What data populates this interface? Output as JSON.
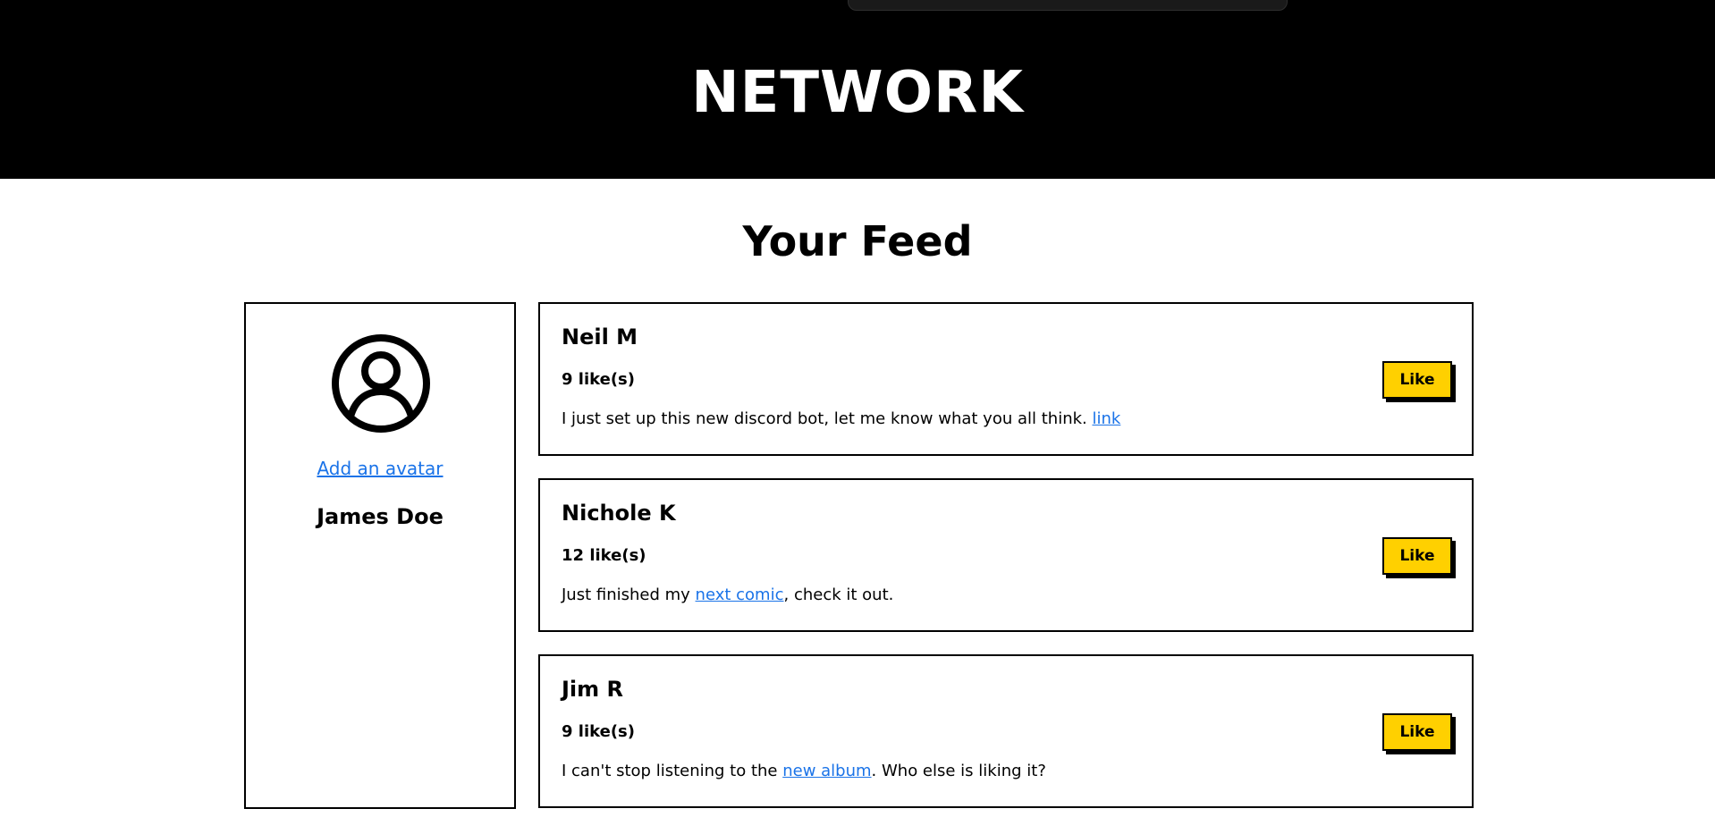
{
  "header": {
    "title": "NETWORK"
  },
  "feed": {
    "title": "Your Feed"
  },
  "profile": {
    "avatar_icon": "user-circle-icon",
    "add_avatar_label": "Add an avatar",
    "name": "James Doe"
  },
  "posts": [
    {
      "author": "Neil M",
      "likes": "9 like(s)",
      "text_before": "I just set up this new discord bot, let me know what you all think. ",
      "link_text": "link",
      "text_after": "",
      "like_label": "Like"
    },
    {
      "author": "Nichole K",
      "likes": "12 like(s)",
      "text_before": "Just finished my ",
      "link_text": "next comic",
      "text_after": ", check it out.",
      "like_label": "Like"
    },
    {
      "author": "Jim R",
      "likes": "9 like(s)",
      "text_before": "I can't stop listening to the ",
      "link_text": "new album",
      "text_after": ". Who else is liking it?",
      "like_label": "Like"
    }
  ],
  "colors": {
    "header_bg": "#000000",
    "link": "#1a73e8",
    "like_button": "#ffd000"
  }
}
